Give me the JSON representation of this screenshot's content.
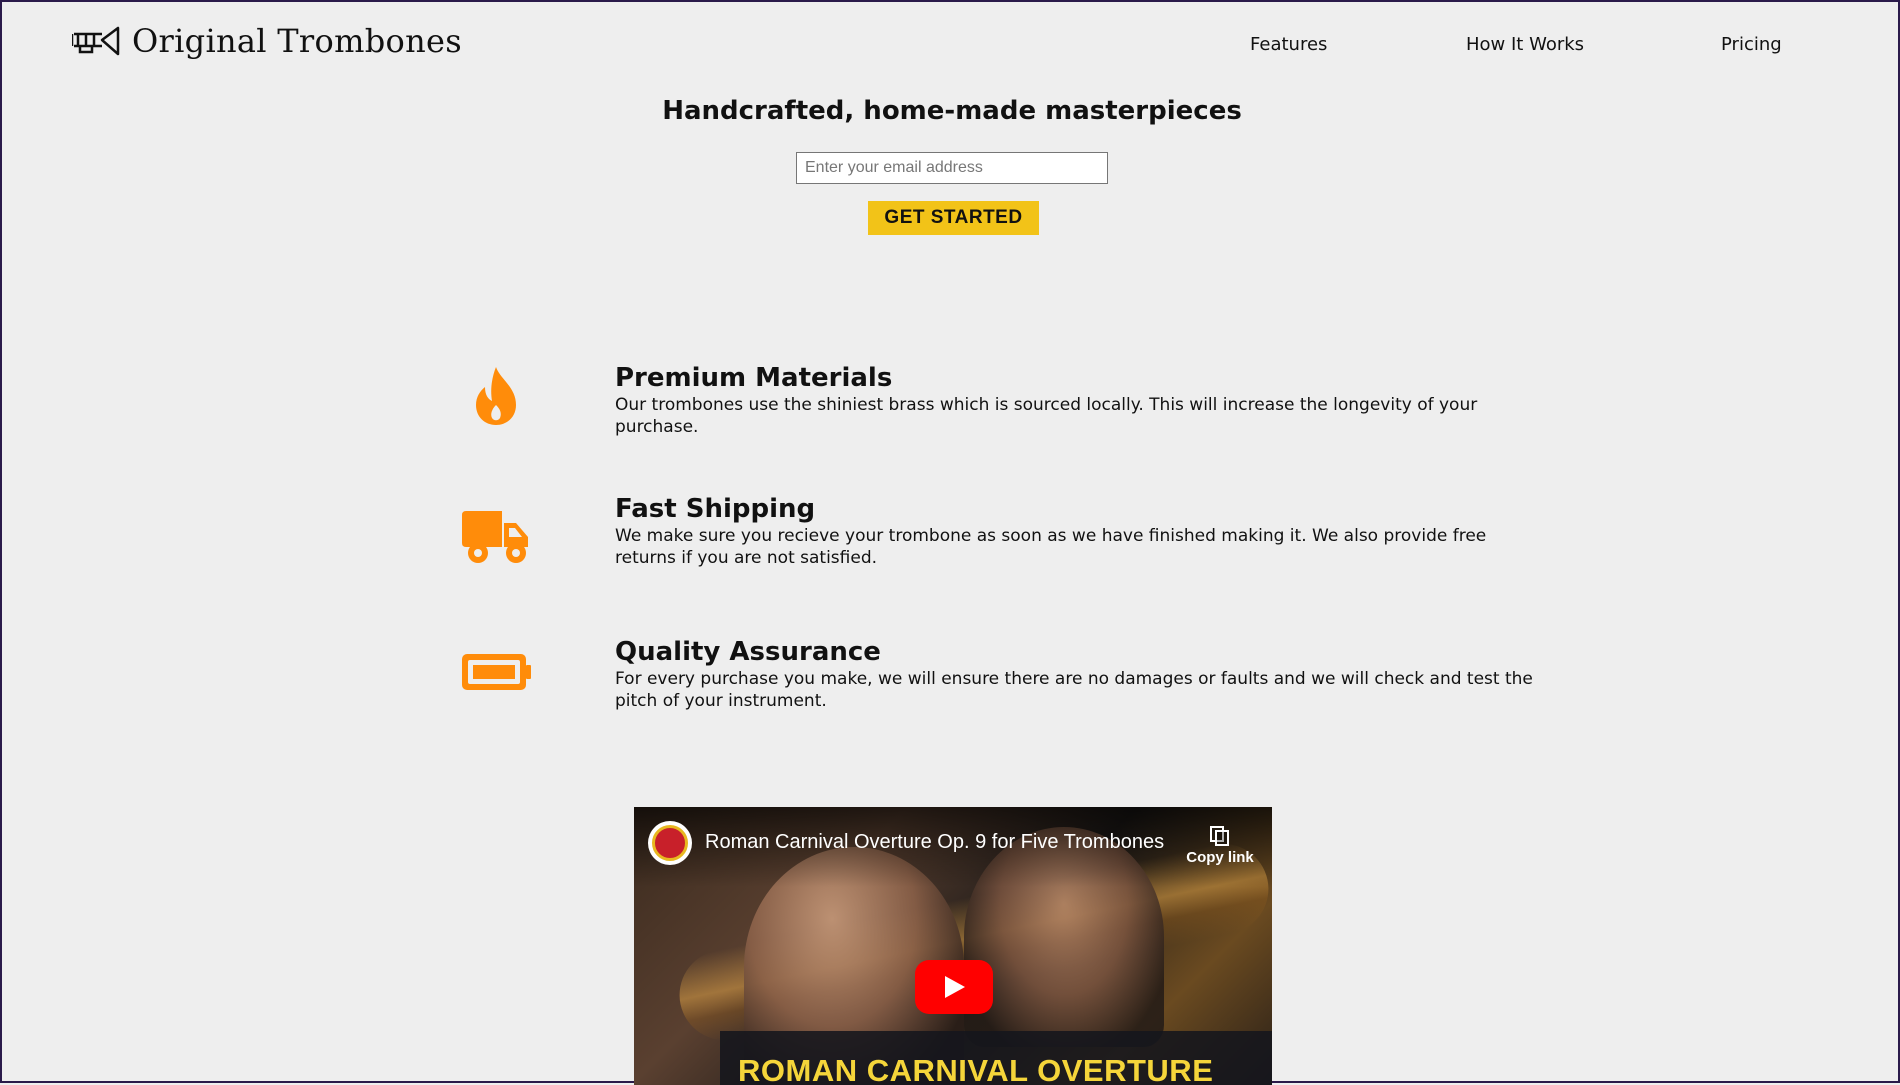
{
  "header": {
    "brand": "Original Trombones",
    "logo_icon": "trombone-icon",
    "nav": [
      {
        "label": "Features"
      },
      {
        "label": "How It Works"
      },
      {
        "label": "Pricing"
      }
    ]
  },
  "hero": {
    "title": "Handcrafted, home-made masterpieces",
    "email_placeholder": "Enter your email address",
    "email_value": "",
    "cta_label": "GET STARTED",
    "cta_color": "#f2c318"
  },
  "features": [
    {
      "icon": "flame-icon",
      "title": "Premium Materials",
      "description": "Our trombones use the shiniest brass which is sourced locally. This will increase the longevity of your purchase."
    },
    {
      "icon": "truck-icon",
      "title": "Fast Shipping",
      "description": "We make sure you recieve your trombone as soon as we have finished making it. We also provide free returns if you are not satisfied."
    },
    {
      "icon": "battery-icon",
      "title": "Quality Assurance",
      "description": "For every purchase you make, we will ensure there are no damages or faults and we will check and test the pitch of your instrument."
    }
  ],
  "icon_color": "#ff8c0a",
  "video": {
    "title": "Roman Carnival Overture Op. 9 for Five Trombones",
    "copy_link_label": "Copy link",
    "banner_text": "ROMAN CARNIVAL OVERTURE",
    "play_icon": "play-icon"
  }
}
